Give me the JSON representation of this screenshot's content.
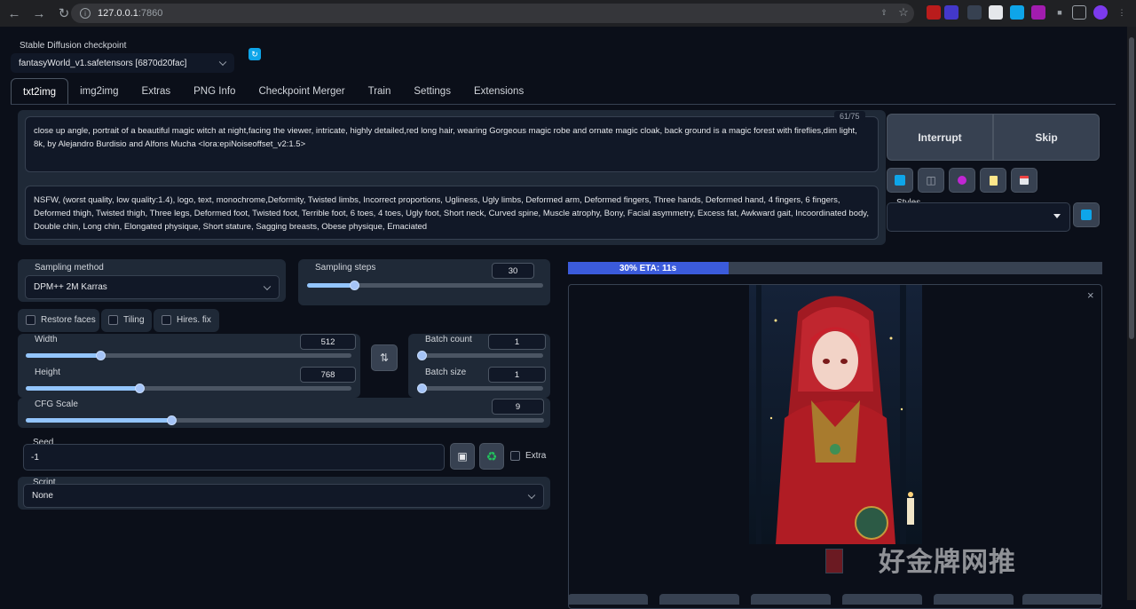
{
  "browser": {
    "url_host": "127.0.0.1",
    "url_port": ":7860"
  },
  "checkpoint": {
    "label": "Stable Diffusion checkpoint",
    "value": "fantasyWorld_v1.safetensors [6870d20fac]"
  },
  "tabs": [
    "txt2img",
    "img2img",
    "Extras",
    "PNG Info",
    "Checkpoint Merger",
    "Train",
    "Settings",
    "Extensions"
  ],
  "prompt": {
    "text": "close up angle, portrait of a beautiful magic witch at night,facing the viewer, intricate, highly detailed,red long hair, wearing Gorgeous magic robe and ornate magic cloak, back ground is a magic forest with fireflies,dim light, 8k, by Alejandro Burdisio and Alfons Mucha <lora:epiNoiseoffset_v2:1.5>",
    "counter": "61/75"
  },
  "negative_prompt": {
    "text": "NSFW, (worst quality, low quality:1.4), logo, text, monochrome,Deformity, Twisted limbs, Incorrect proportions, Ugliness, Ugly limbs, Deformed arm, Deformed fingers, Three hands, Deformed hand, 4 fingers, 6 fingers, Deformed thigh, Twisted thigh, Three legs, Deformed foot, Twisted foot, Terrible foot, 6 toes, 4 toes, Ugly foot, Short neck, Curved spine, Muscle atrophy, Bony, Facial asymmetry, Excess fat, Awkward gait, Incoordinated body, Double chin, Long chin, Elongated physique, Short stature, Sagging breasts, Obese physique, Emaciated"
  },
  "actions": {
    "interrupt": "Interrupt",
    "skip": "Skip",
    "styles_label": "Styles"
  },
  "sampling": {
    "method_label": "Sampling method",
    "method_value": "DPM++ 2M Karras",
    "steps_label": "Sampling steps",
    "steps_value": "30",
    "steps_fraction": 0.2
  },
  "options": {
    "restore_faces": "Restore faces",
    "tiling": "Tiling",
    "hires_fix": "Hires. fix"
  },
  "width": {
    "label": "Width",
    "value": "512",
    "fraction": 0.23
  },
  "height": {
    "label": "Height",
    "value": "768",
    "fraction": 0.35
  },
  "batch_count": {
    "label": "Batch count",
    "value": "1",
    "fraction": 0
  },
  "batch_size": {
    "label": "Batch size",
    "value": "1",
    "fraction": 0
  },
  "cfg": {
    "label": "CFG Scale",
    "value": "9",
    "fraction": 0.28
  },
  "seed": {
    "label": "Seed",
    "value": "-1",
    "extra": "Extra"
  },
  "script": {
    "label": "Script",
    "value": "None"
  },
  "progress": {
    "text": "30% ETA: 11s",
    "fraction": 0.3
  },
  "watermark": "好金牌网推"
}
